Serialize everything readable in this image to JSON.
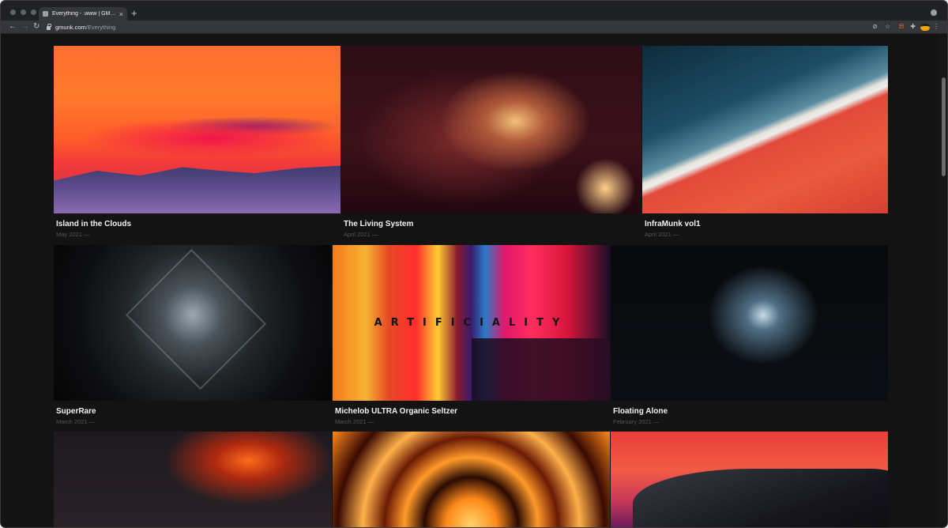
{
  "browser": {
    "tab_title": "Everything - .www | GMUNK",
    "tab_close": "×",
    "new_tab": "+",
    "url_domain": "gmunk.com",
    "url_path": "/Everything",
    "nav_back": "←",
    "nav_forward": "→",
    "nav_reload": "↻",
    "icons": [
      "eye-slash-icon",
      "star-icon",
      "brave-shield-icon",
      "extensions-icon",
      "profile-pill-icon",
      "kebab-menu-icon"
    ],
    "icon_glyphs": {
      "eye_slash": "⊘",
      "star": "☆",
      "brave": "ᗸ",
      "extensions": "✚",
      "menu": "⋮"
    }
  },
  "gallery": {
    "row1": [
      {
        "title": "Island in the Clouds",
        "date": "May 2021 —"
      },
      {
        "title": "The Living System",
        "date": "April 2021 —"
      },
      {
        "title": "InfraMunk vol1",
        "date": "April 2021 —"
      }
    ],
    "row2": [
      {
        "title": "SuperRare",
        "date": "March 2021 —"
      },
      {
        "title": "Michelob ULTRA Organic Seltzer",
        "date": "March 2021 —",
        "artwork_text": "ARTIFICIALITY"
      },
      {
        "title": "Floating Alone",
        "date": "February 2021 —"
      }
    ],
    "row3": [
      {
        "title": "",
        "date": ""
      },
      {
        "title": "",
        "date": ""
      },
      {
        "title": "",
        "date": ""
      }
    ]
  }
}
